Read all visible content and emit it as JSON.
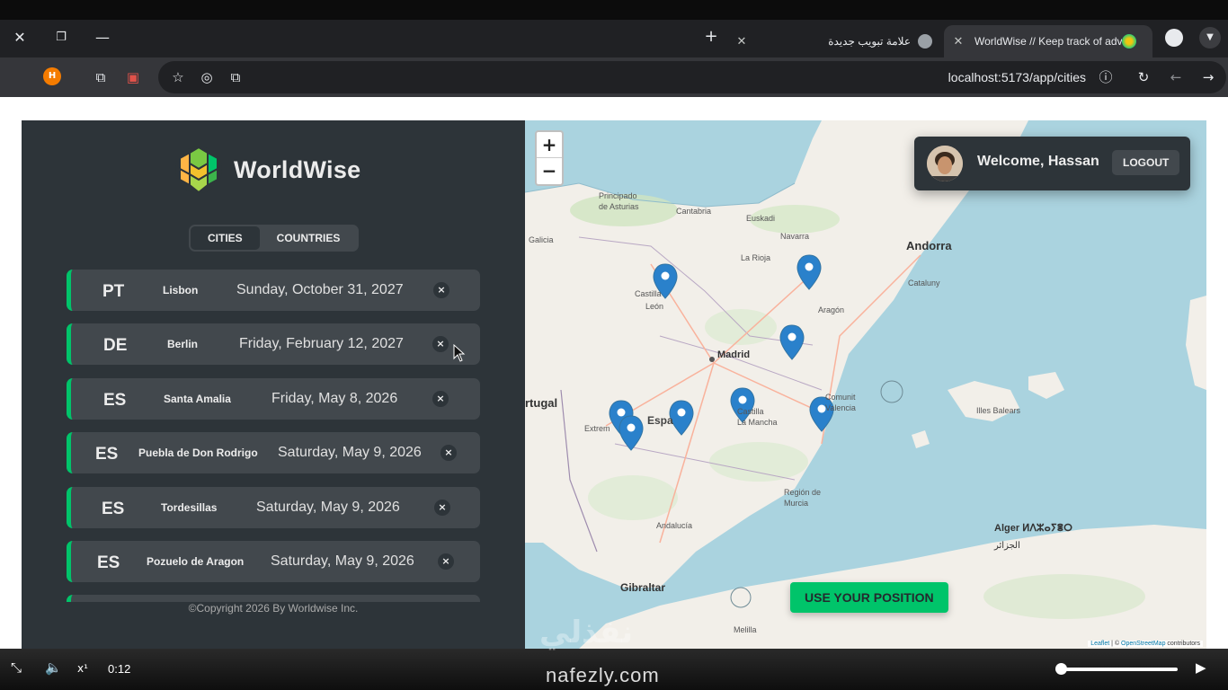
{
  "browser": {
    "tabs": [
      {
        "title": "علامة تبويب جديدة",
        "active": false
      },
      {
        "title": "WorldWise // Keep track of adv",
        "active": true
      }
    ],
    "url": "localhost:5173/app/cities",
    "profile_initial": "H"
  },
  "app": {
    "logo_text": "WorldWise",
    "tabs": {
      "cities": "CITIES",
      "countries": "COUNTRIES"
    },
    "cities": [
      {
        "code": "PT",
        "name": "Lisbon",
        "date": "Sunday, October 31, 2027"
      },
      {
        "code": "DE",
        "name": "Berlin",
        "date": "Friday, February 12, 2027"
      },
      {
        "code": "ES",
        "name": "Santa Amalia",
        "date": "Friday, May 8, 2026"
      },
      {
        "code": "ES",
        "name": "Puebla de Don Rodrigo",
        "date": "Saturday, May 9, 2026"
      },
      {
        "code": "ES",
        "name": "Tordesillas",
        "date": "Saturday, May 9, 2026"
      },
      {
        "code": "ES",
        "name": "Pozuelo de Aragon",
        "date": "Saturday, May 9, 2026"
      }
    ],
    "delete_symbol": "×",
    "footer": "©Copyright 2026 By Worldwise Inc."
  },
  "map": {
    "zoom_in": "+",
    "zoom_out": "−",
    "user": {
      "welcome": "Welcome, Hassan",
      "logout": "LOGOUT"
    },
    "use_position": "USE YOUR POSITION",
    "attribution": {
      "leaflet": "Leaflet",
      "sep": " | © ",
      "osm": "OpenStreetMap",
      "tail": " contributors"
    },
    "labels": {
      "andorra": "Andorra",
      "madrid": "Madrid",
      "portugal": "rtugal",
      "espana": "Espa",
      "gibraltar": "Gibraltar",
      "alger": "Alger ⵍⴷⵣⴰⵢⴻⵔ",
      "alger_ar": "الجزائر",
      "principado": "Principado\nde Asturias",
      "cantabria": "Cantabria",
      "euskadi": "Euskadi",
      "navarra": "Navarra",
      "larioja": "La Rioja",
      "castilla": "Castilla",
      "leon": "León",
      "aragon": "Aragón",
      "catalunya": "Cataluny",
      "galicia": "Galicia",
      "extremadura": "Extrem",
      "mancha": "Castilla\nLa Mancha",
      "comunitat": "Comunit\nValencia",
      "illes": "Illes Balears",
      "murcia": "Región de\nMurcia",
      "andalucia": "Andalucía",
      "ceuta": "Melilla"
    },
    "colors": {
      "water": "#aad3df",
      "land": "#f2efe9",
      "marker": "#2a81cb"
    }
  },
  "video": {
    "time": "0:12",
    "watermark": "nafezly.com",
    "watermark_ar": "نفذلي",
    "progress": 0.04
  }
}
